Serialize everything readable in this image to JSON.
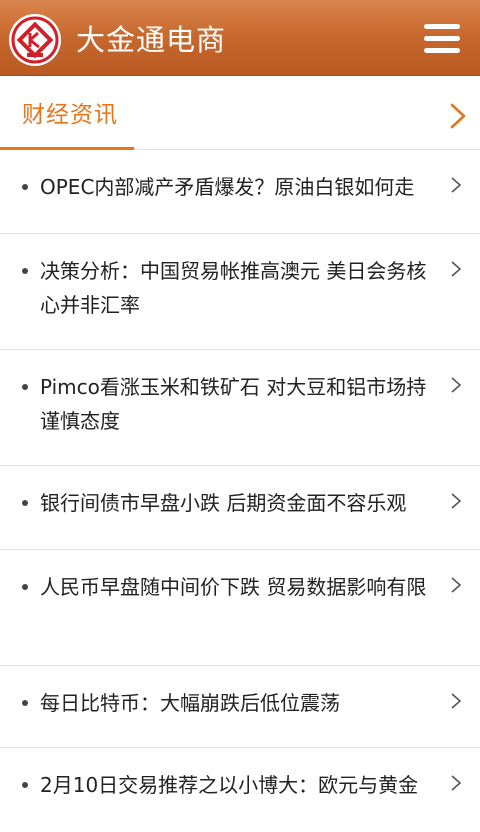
{
  "header": {
    "app_title": "大金通电商",
    "logo_icon": "company-logo",
    "menu_icon": "hamburger-menu-icon",
    "colors": {
      "bar_top": "#d9854e",
      "bar_bottom": "#b85a22"
    }
  },
  "section": {
    "title": "财经资讯",
    "accent_color": "#e8751a",
    "more_icon": "chevron-right-icon"
  },
  "news": [
    {
      "title": "OPEC内部减产矛盾爆发？原油白银如何走"
    },
    {
      "title": "决策分析：中国贸易帐推高澳元 美日会务核心并非汇率"
    },
    {
      "title": "Pimco看涨玉米和铁矿石 对大豆和铝市场持谨慎态度"
    },
    {
      "title": "银行间债市早盘小跌 后期资金面不容乐观"
    },
    {
      "title": "人民币早盘随中间价下跌 贸易数据影响有限"
    },
    {
      "title": "每日比特币：大幅崩跌后低位震荡"
    },
    {
      "title": "2月10日交易推荐之以小博大：欧元与黄金"
    }
  ]
}
